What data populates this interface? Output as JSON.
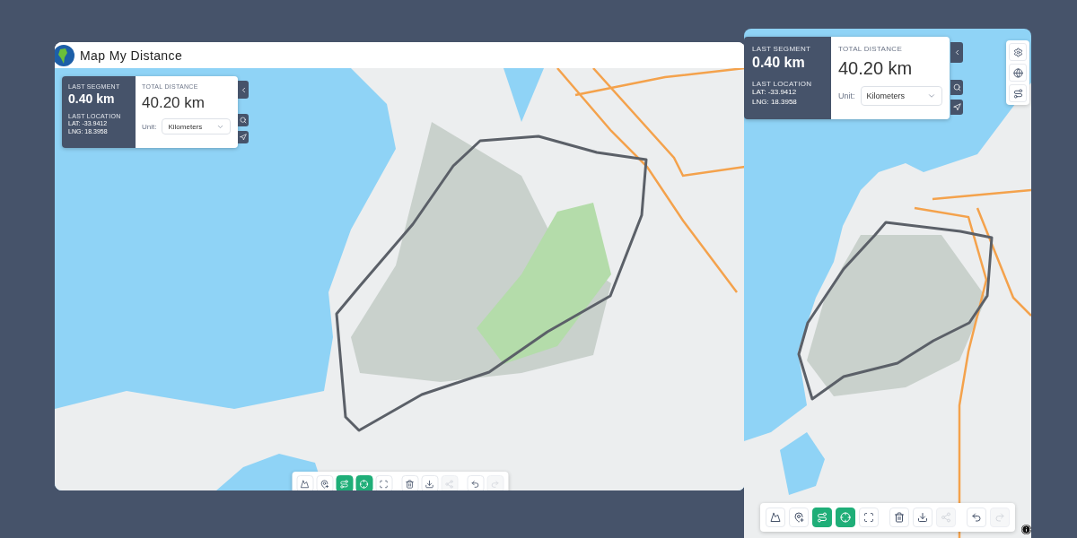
{
  "app": {
    "title": "Map My Distance"
  },
  "desktop": {
    "panel": {
      "last_segment_label": "LAST SEGMENT",
      "last_segment": "0.40 km",
      "last_location_label": "LAST LOCATION",
      "lat": "LAT: -33.9412",
      "lng": "LNG: 18.3958",
      "total_label": "TOTAL DISTANCE",
      "total": "40.20 km",
      "unit_label": "Unit:",
      "unit": "Kilometers"
    },
    "toolbar": [
      {
        "tools": [
          {
            "kind": "terrain",
            "selected": false,
            "disabled": false
          },
          {
            "kind": "add-pin",
            "selected": false,
            "disabled": false
          },
          {
            "kind": "route",
            "selected": true,
            "disabled": false
          },
          {
            "kind": "target",
            "selected": true,
            "disabled": false
          },
          {
            "kind": "fit",
            "selected": false,
            "disabled": false
          }
        ]
      },
      {
        "tools": [
          {
            "kind": "delete",
            "selected": false,
            "disabled": false
          },
          {
            "kind": "download",
            "selected": false,
            "disabled": false
          },
          {
            "kind": "share",
            "selected": false,
            "disabled": true
          }
        ]
      },
      {
        "tools": [
          {
            "kind": "undo",
            "selected": false,
            "disabled": false
          },
          {
            "kind": "redo",
            "selected": false,
            "disabled": true
          }
        ]
      }
    ]
  },
  "mobile": {
    "panel": {
      "last_segment_label": "LAST SEGMENT",
      "last_segment": "0.40 km",
      "last_location_label": "LAST LOCATION",
      "lat": "LAT: -33.9412",
      "lng": "LNG: 18.3958",
      "total_label": "TOTAL DISTANCE",
      "total": "40.20 km",
      "unit_label": "Unit:",
      "unit": "Kilometers"
    },
    "map_controls": [
      {
        "kind": "settings"
      },
      {
        "kind": "globe"
      },
      {
        "kind": "route"
      }
    ],
    "toolbar": [
      {
        "tools": [
          {
            "kind": "terrain",
            "selected": false,
            "disabled": false
          },
          {
            "kind": "add-pin",
            "selected": false,
            "disabled": false
          },
          {
            "kind": "route",
            "selected": true,
            "disabled": false
          },
          {
            "kind": "target",
            "selected": true,
            "disabled": false
          },
          {
            "kind": "fit",
            "selected": false,
            "disabled": false
          }
        ]
      },
      {
        "tools": [
          {
            "kind": "delete",
            "selected": false,
            "disabled": false
          },
          {
            "kind": "download",
            "selected": false,
            "disabled": false
          },
          {
            "kind": "share",
            "selected": false,
            "disabled": true
          }
        ]
      },
      {
        "tools": [
          {
            "kind": "undo",
            "selected": false,
            "disabled": false
          },
          {
            "kind": "redo",
            "selected": false,
            "disabled": true
          }
        ]
      }
    ]
  }
}
